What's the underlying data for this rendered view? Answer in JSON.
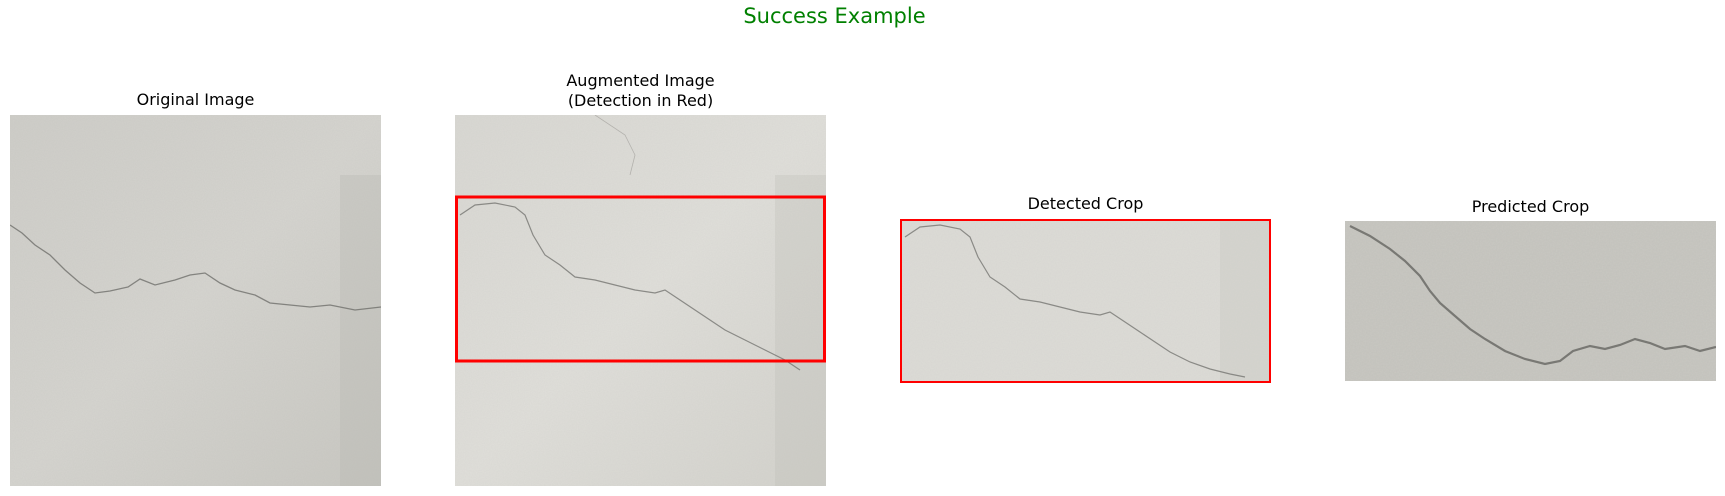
{
  "figure": {
    "title": "Success Example",
    "title_color": "#008000"
  },
  "panels": [
    {
      "title": "Original Image"
    },
    {
      "title": "Augmented Image\n(Detection in Red)"
    },
    {
      "title": "Detected Crop"
    },
    {
      "title": "Predicted Crop"
    }
  ],
  "detection_box_color": "#ff0000"
}
